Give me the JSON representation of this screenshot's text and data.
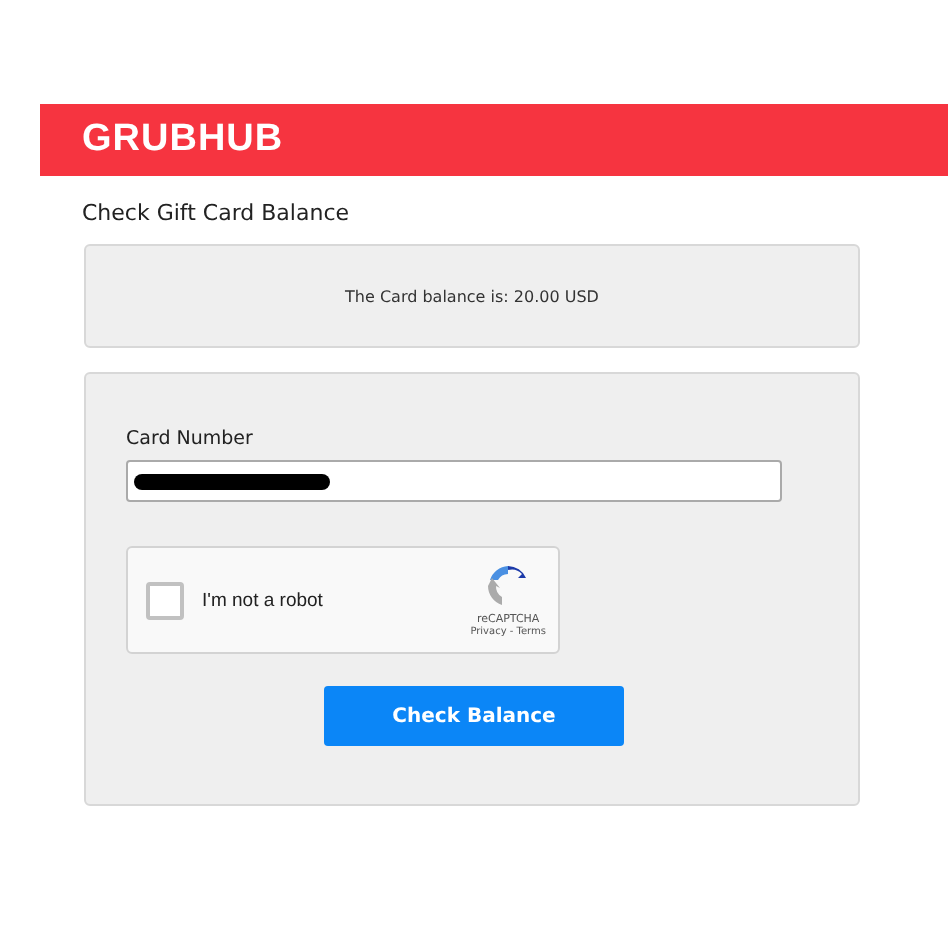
{
  "header": {
    "logo": "GRUBHUB"
  },
  "title": "Check Gift Card Balance",
  "balance": {
    "message": "The Card balance is: 20.00 USD"
  },
  "form": {
    "card_number": {
      "label": "Card Number",
      "redacted": true
    },
    "captcha": {
      "label": "I'm not a robot",
      "checked": false,
      "brand": "reCAPTCHA",
      "links": "Privacy - Terms"
    },
    "submit": "Check Balance"
  }
}
